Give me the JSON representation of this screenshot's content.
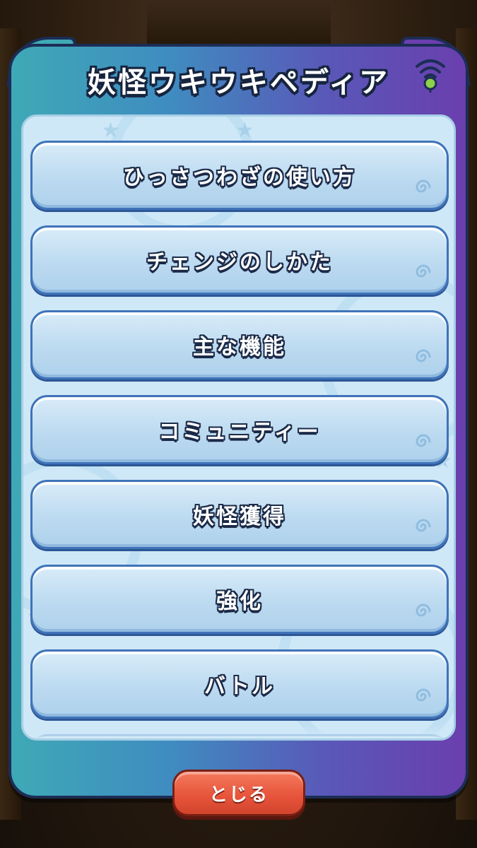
{
  "dialog": {
    "title": "妖怪ウキウキペディア"
  },
  "menu": {
    "items": [
      {
        "label": "ひっさつわざの使い方"
      },
      {
        "label": "チェンジのしかた"
      },
      {
        "label": "主な機能"
      },
      {
        "label": "コミュニティー"
      },
      {
        "label": "妖怪獲得"
      },
      {
        "label": "強化"
      },
      {
        "label": "バトル"
      },
      {
        "label": ""
      }
    ]
  },
  "footer": {
    "close_label": "とじる"
  },
  "colors": {
    "frame_left": "#3fa9b6",
    "frame_right": "#6a3fae",
    "panel": "#cfe8f7",
    "item_border": "#3f73b8",
    "close_button": "#e6533a"
  },
  "icons": {
    "antenna": "antenna-icon",
    "item_decoration": "swirl-icon"
  }
}
